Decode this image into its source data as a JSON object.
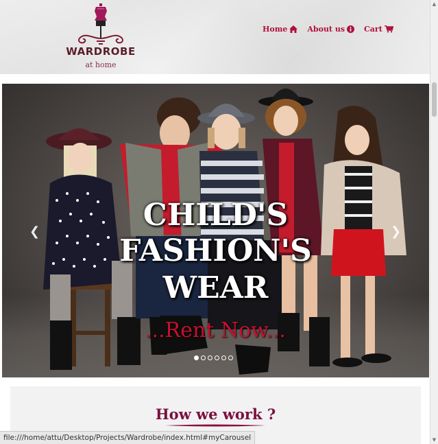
{
  "brand": {
    "name": "WARDROBE",
    "tagline": "at home"
  },
  "nav": [
    {
      "label": "Home",
      "icon": "home-icon"
    },
    {
      "label": "About us",
      "icon": "info-icon"
    },
    {
      "label": "Cart",
      "icon": "cart-icon"
    }
  ],
  "carousel": {
    "caption_lines": [
      "CHILD'S",
      "FASHION'S",
      "WEAR"
    ],
    "cta": "...Rent Now...",
    "slide_count": 6,
    "active_slide": 1,
    "prev_icon": "chevron-left-icon",
    "next_icon": "chevron-right-icon"
  },
  "how_we_work": {
    "title": "How we work ?"
  },
  "status_bar": {
    "url": "file:///home/attu/Desktop/Projects/Wardrobe/index.html#myCarousel"
  },
  "colors": {
    "accent": "#b0103c",
    "heading": "#7a1040",
    "cta": "#c8102e",
    "logo": "#5a1e2a"
  }
}
